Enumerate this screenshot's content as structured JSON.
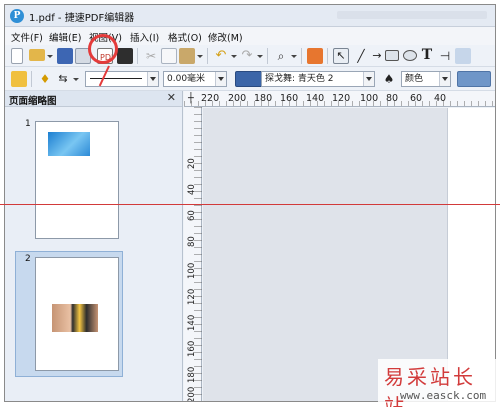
{
  "window": {
    "title": "1.pdf - 捷速PDF编辑器"
  },
  "menubar": {
    "items": [
      {
        "label": "文件(F)"
      },
      {
        "label": "编辑(E)"
      },
      {
        "label": "视图(V)"
      },
      {
        "label": "插入(I)"
      },
      {
        "label": "格式(O)"
      },
      {
        "label": "修改(M)"
      }
    ]
  },
  "toolbar2": {
    "line_width": "0.00毫米",
    "fill_style": "探戈舞: 青天色 2",
    "color_combo": "颜色"
  },
  "sidebar": {
    "title": "页面缩略图",
    "close_glyph": "✕",
    "thumbs": [
      {
        "num": "1"
      },
      {
        "num": "2"
      }
    ]
  },
  "ruler": {
    "h_labels": [
      "220",
      "200",
      "180",
      "160",
      "140",
      "120",
      "100",
      "80",
      "60",
      "40"
    ],
    "v_labels": [
      "20",
      "40",
      "60",
      "80",
      "100",
      "120",
      "140",
      "160",
      "180",
      "200"
    ]
  },
  "watermark": {
    "text": "易采站长站",
    "url": "www.easck.com"
  },
  "colors": {
    "accent": "#2f8fd6",
    "annotation": "#e43b3b",
    "watermark": "#d23b3b"
  }
}
